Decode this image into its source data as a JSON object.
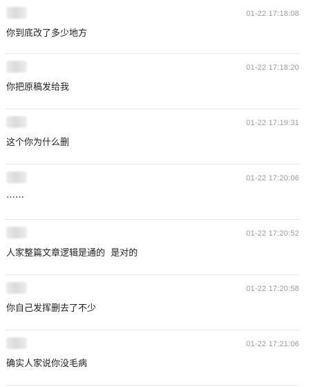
{
  "comments": [
    {
      "time": "01-22 17:18:08",
      "text": "你到底改了多少地方"
    },
    {
      "time": "01-22 17:18:20",
      "text": "你把原稿发给我"
    },
    {
      "time": "01-22 17:19:31",
      "text": "这个你为什么删"
    },
    {
      "time": "01-22 17:20:06",
      "text": "……"
    },
    {
      "time": "01-22 17:20:52",
      "text": "人家整篇文章逻辑是通的  是对的"
    },
    {
      "time": "01-22 17:20:58",
      "text": "你自己发挥删去了不少"
    },
    {
      "time": "01-22 17:21:06",
      "text": "确实人家说你没毛病"
    }
  ]
}
